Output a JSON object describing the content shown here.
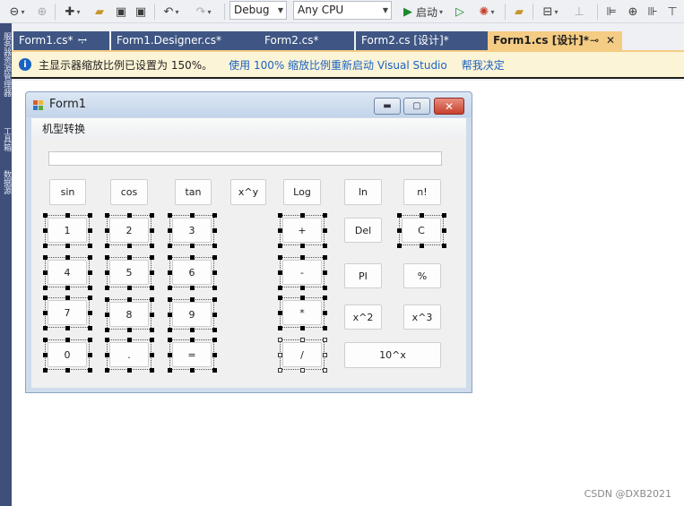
{
  "toolbar": {
    "config": "Debug",
    "platform": "Any CPU",
    "start_label": "启动"
  },
  "left_strip": {
    "labels": [
      "服务器资源管理器",
      "工具箱",
      "数据源"
    ]
  },
  "tabs": [
    {
      "label": "Form1.cs*",
      "active": false
    },
    {
      "label": "Form1.Designer.cs*",
      "active": false
    },
    {
      "label": "Form2.cs*",
      "active": false
    },
    {
      "label": "Form2.cs [设计]*",
      "active": false
    },
    {
      "label": "Form1.cs [设计]*",
      "active": true
    }
  ],
  "infobar": {
    "message": "主显示器缩放比例已设置为 150%。",
    "link_restart": "使用 100% 缩放比例重新启动 Visual Studio",
    "link_decide": "帮我决定"
  },
  "form": {
    "title": "Form1",
    "menu": [
      "机型转换"
    ],
    "buttons": [
      {
        "id": "sin",
        "label": "sin"
      },
      {
        "id": "cos",
        "label": "cos"
      },
      {
        "id": "tan",
        "label": "tan"
      },
      {
        "id": "pow",
        "label": "x^y"
      },
      {
        "id": "log",
        "label": "Log"
      },
      {
        "id": "ln",
        "label": "ln"
      },
      {
        "id": "fact",
        "label": "n!"
      },
      {
        "id": "d1",
        "label": "1"
      },
      {
        "id": "d2",
        "label": "2"
      },
      {
        "id": "d3",
        "label": "3"
      },
      {
        "id": "plus",
        "label": "+"
      },
      {
        "id": "del",
        "label": "Del"
      },
      {
        "id": "clear",
        "label": "C"
      },
      {
        "id": "d4",
        "label": "4"
      },
      {
        "id": "d5",
        "label": "5"
      },
      {
        "id": "d6",
        "label": "6"
      },
      {
        "id": "minus",
        "label": "-"
      },
      {
        "id": "pi",
        "label": "PI"
      },
      {
        "id": "percent",
        "label": "%"
      },
      {
        "id": "d7",
        "label": "7"
      },
      {
        "id": "d8",
        "label": "8"
      },
      {
        "id": "d9",
        "label": "9"
      },
      {
        "id": "mul",
        "label": "*"
      },
      {
        "id": "sq",
        "label": "x^2"
      },
      {
        "id": "cube",
        "label": "x^3"
      },
      {
        "id": "d0",
        "label": "0"
      },
      {
        "id": "dot",
        "label": "."
      },
      {
        "id": "eq",
        "label": "="
      },
      {
        "id": "div",
        "label": "/"
      },
      {
        "id": "tenx",
        "label": "10^x"
      }
    ]
  },
  "watermark": "CSDN @DXB2021"
}
